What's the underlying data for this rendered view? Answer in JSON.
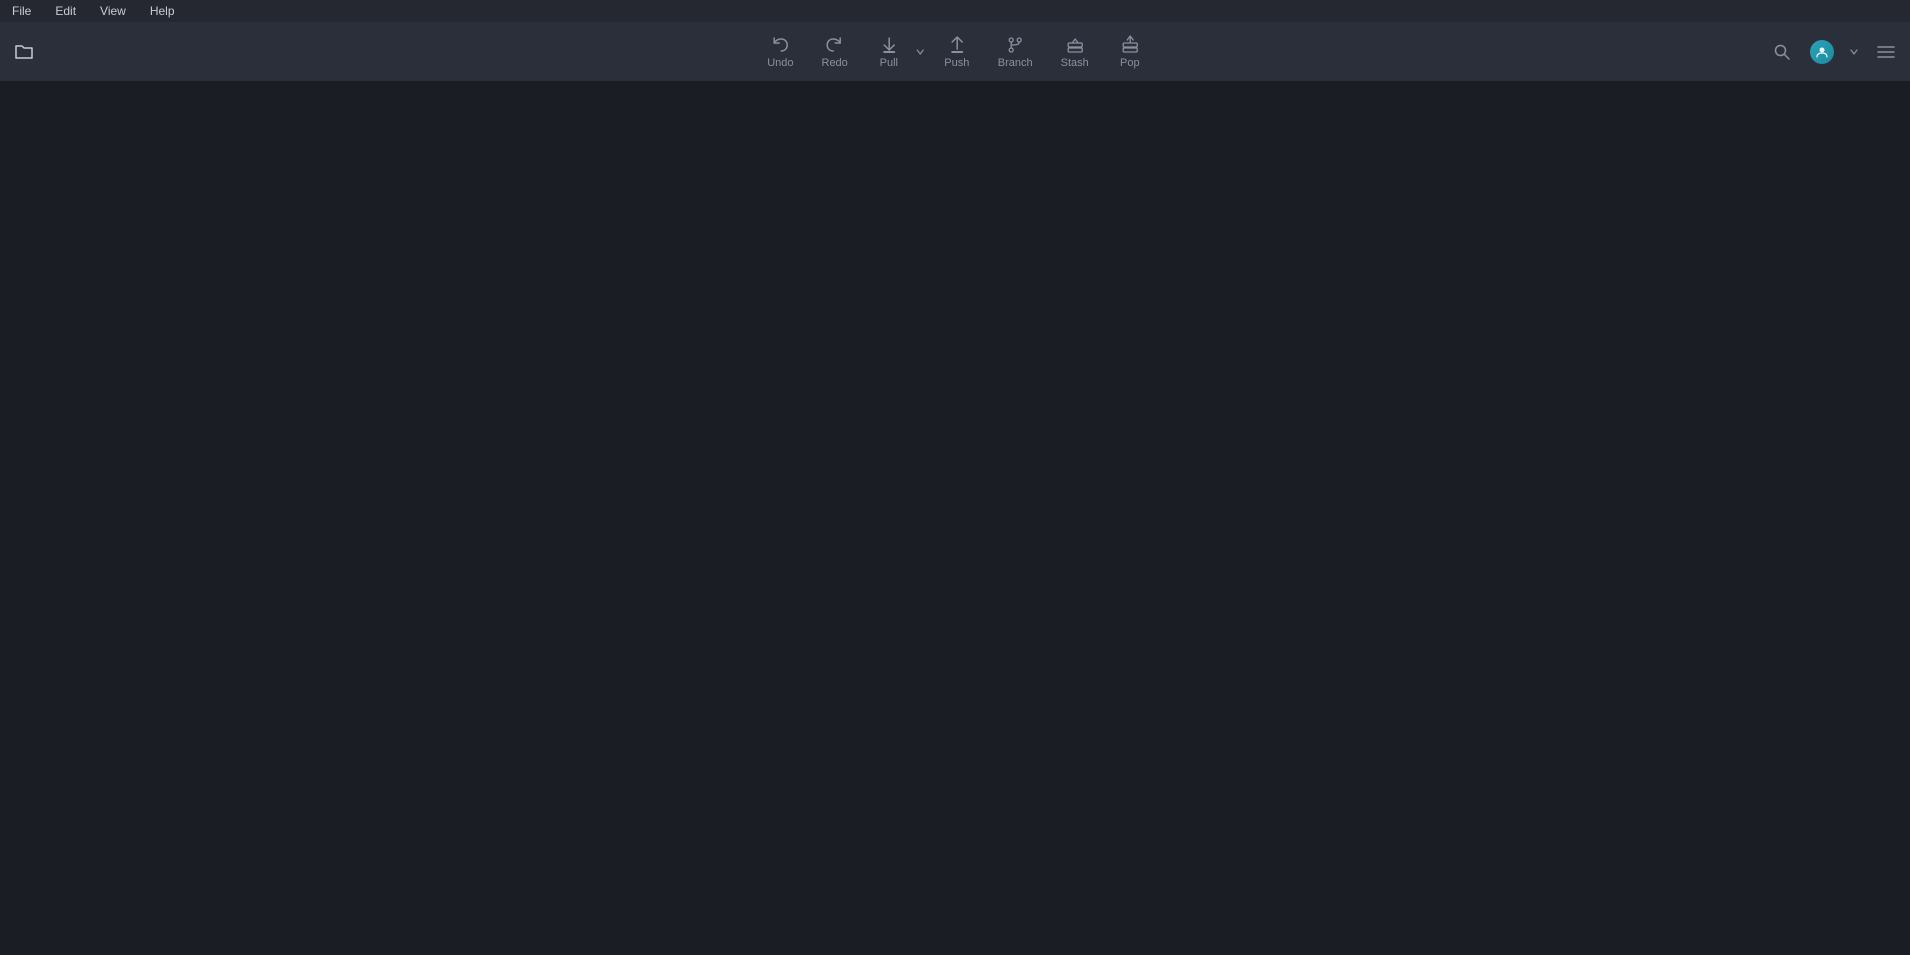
{
  "menu": {
    "items": [
      {
        "label": "File",
        "id": "file"
      },
      {
        "label": "Edit",
        "id": "edit"
      },
      {
        "label": "View",
        "id": "view"
      },
      {
        "label": "Help",
        "id": "help"
      }
    ]
  },
  "toolbar": {
    "undo_label": "Undo",
    "redo_label": "Redo",
    "pull_label": "Pull",
    "push_label": "Push",
    "branch_label": "Branch",
    "stash_label": "Stash",
    "pop_label": "Pop"
  }
}
